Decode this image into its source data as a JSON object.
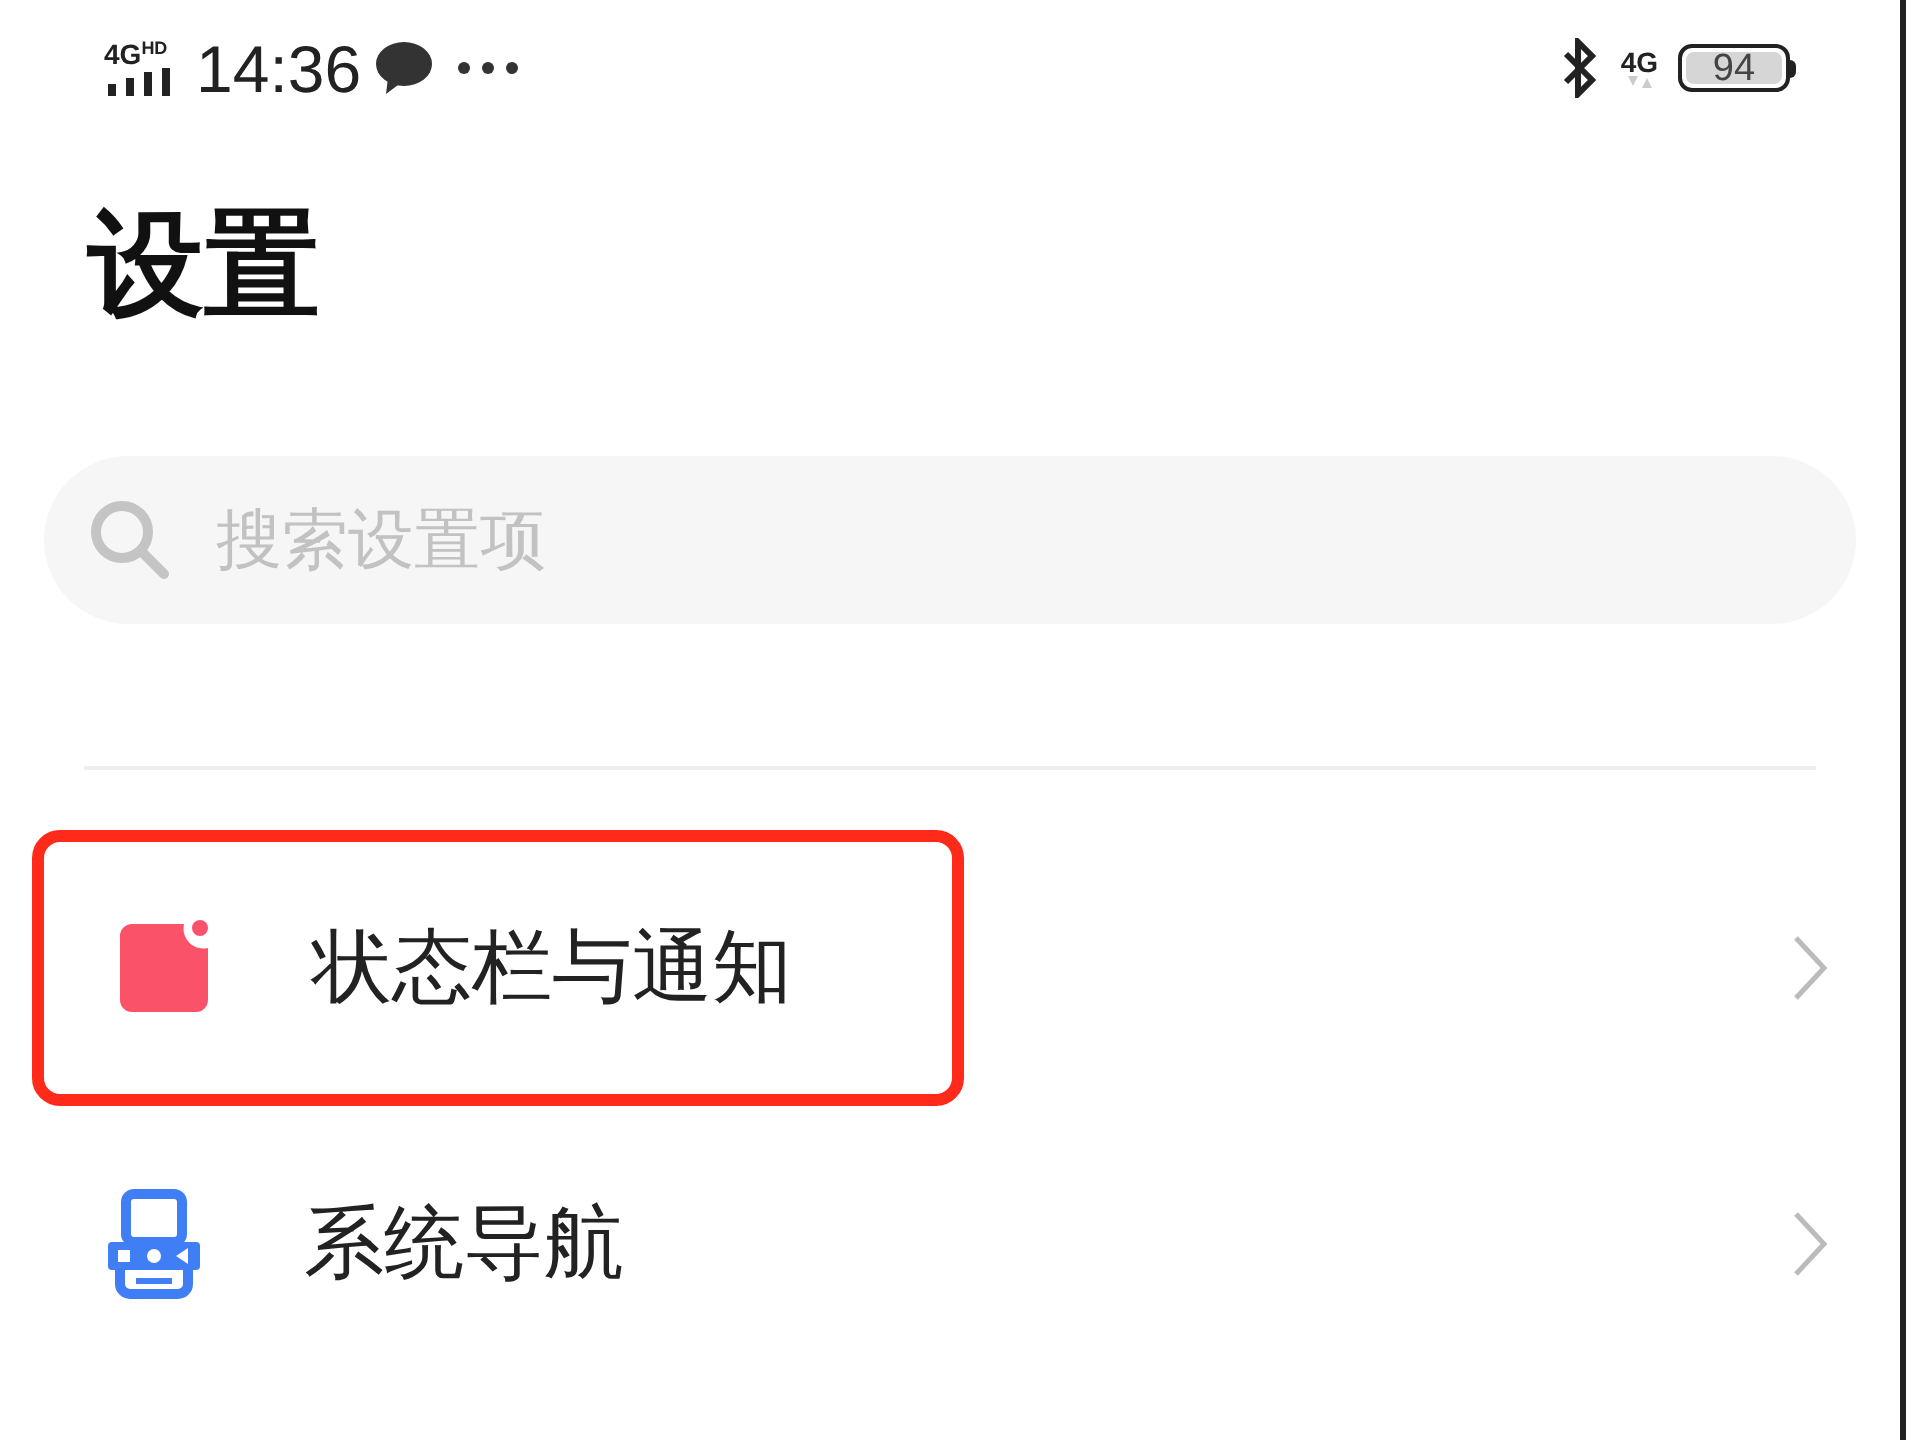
{
  "status_bar": {
    "network": "4G",
    "network_badge": "HD",
    "time": "14:36",
    "data_network": "4G",
    "battery": "94"
  },
  "title": "设置",
  "search": {
    "placeholder": "搜索设置项"
  },
  "items": [
    {
      "label": "状态栏与通知",
      "kind": "notification",
      "highlighted": true
    },
    {
      "label": "系统导航",
      "kind": "navigation",
      "highlighted": false
    }
  ]
}
